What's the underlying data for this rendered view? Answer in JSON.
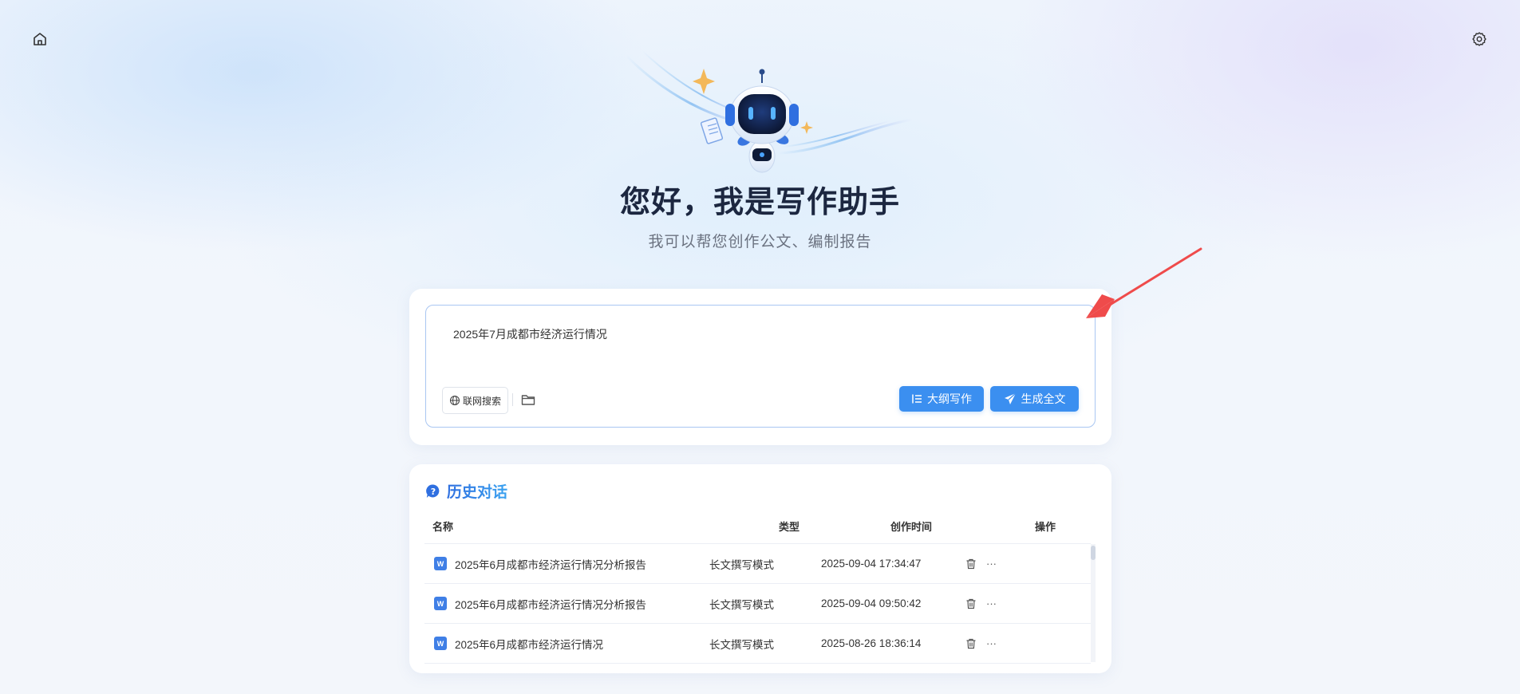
{
  "nav": {
    "home_icon": "home-icon",
    "settings_icon": "gear-icon"
  },
  "hero": {
    "title": "您好，我是写作助手",
    "subtitle": "我可以帮您创作公文、编制报告"
  },
  "composer": {
    "query": "2025年7月成都市经济运行情况",
    "web_search_label": "联网搜索",
    "outline_label": "大纲写作",
    "generate_label": "生成全文"
  },
  "history": {
    "title": "历史对话",
    "columns": {
      "name": "名称",
      "type": "类型",
      "time": "创作时间",
      "ops": "操作"
    },
    "rows": [
      {
        "name": "2025年6月成都市经济运行情况分析报告",
        "type": "长文撰写模式",
        "time": "2025-09-04 17:34:47",
        "more": "···"
      },
      {
        "name": "2025年6月成都市经济运行情况分析报告",
        "type": "长文撰写模式",
        "time": "2025-09-04 09:50:42",
        "more": "···"
      },
      {
        "name": "2025年6月成都市经济运行情况",
        "type": "长文撰写模式",
        "time": "2025-08-26 18:36:14",
        "more": "···"
      }
    ]
  },
  "colors": {
    "accent": "#3b8ff0",
    "annotation_arrow": "#ef4b4b"
  }
}
